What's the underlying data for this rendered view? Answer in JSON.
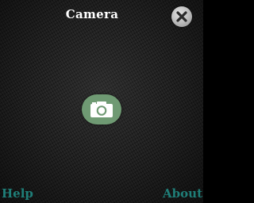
{
  "header": {
    "title": "Camera",
    "close_icon": "close-icon"
  },
  "main": {
    "camera_icon": "camera-icon",
    "camera_button_color": "#6f9a73"
  },
  "footer": {
    "help_label": "Help",
    "about_label": "About",
    "link_color": "#1f7e78"
  }
}
